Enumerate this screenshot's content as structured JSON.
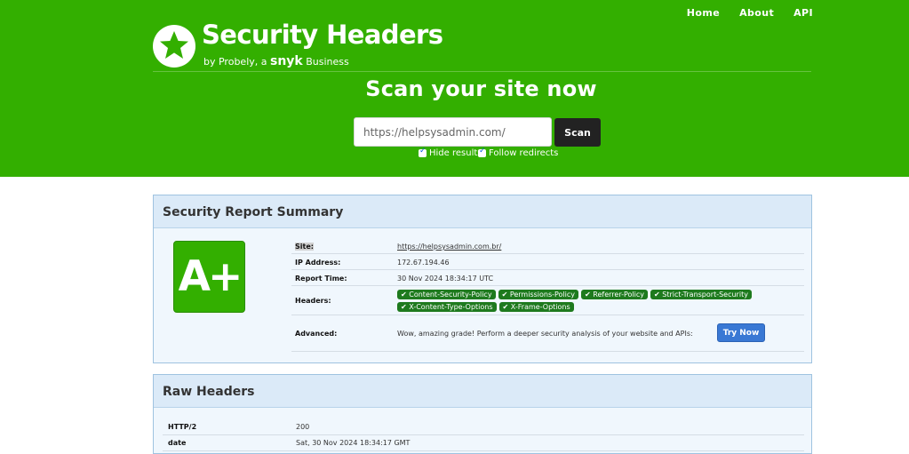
{
  "nav": [
    "Home",
    "About",
    "API"
  ],
  "brand": {
    "title": "Security Headers",
    "subtitle_prefix": "by Probely, a ",
    "subtitle_snyk": "snyk",
    "subtitle_suffix": " Business"
  },
  "scan": {
    "heading": "Scan your site now",
    "input_value": "https://helpsysadmin.com/",
    "button_label": "Scan",
    "options": [
      "Hide results",
      "Follow redirects"
    ]
  },
  "summary": {
    "title": "Security Report Summary",
    "grade": "A+",
    "site_label": "Site:",
    "site_value": "https://helpsysadmin.com.br/",
    "ip_label": "IP Address:",
    "ip_value": "172.67.194.46",
    "time_label": "Report Time:",
    "time_value": "30 Nov 2024 18:34:17 UTC",
    "headers_label": "Headers:",
    "headers": [
      "Content-Security-Policy",
      "Permissions-Policy",
      "Referrer-Policy",
      "Strict-Transport-Security",
      "X-Content-Type-Options",
      "X-Frame-Options"
    ],
    "advanced_label": "Advanced:",
    "advanced_text": "Wow, amazing grade! Perform a deeper security analysis of your website and APIs:",
    "try_button": "Try Now"
  },
  "raw": {
    "title": "Raw Headers",
    "rows": [
      {
        "key": "HTTP/2",
        "value": "200"
      },
      {
        "key": "date",
        "value": "Sat, 30 Nov 2024 18:34:17 GMT"
      }
    ]
  },
  "colors": {
    "brand_green": "#33af00",
    "badge_green": "#1e7a1e",
    "button_blue": "#3978d4"
  }
}
